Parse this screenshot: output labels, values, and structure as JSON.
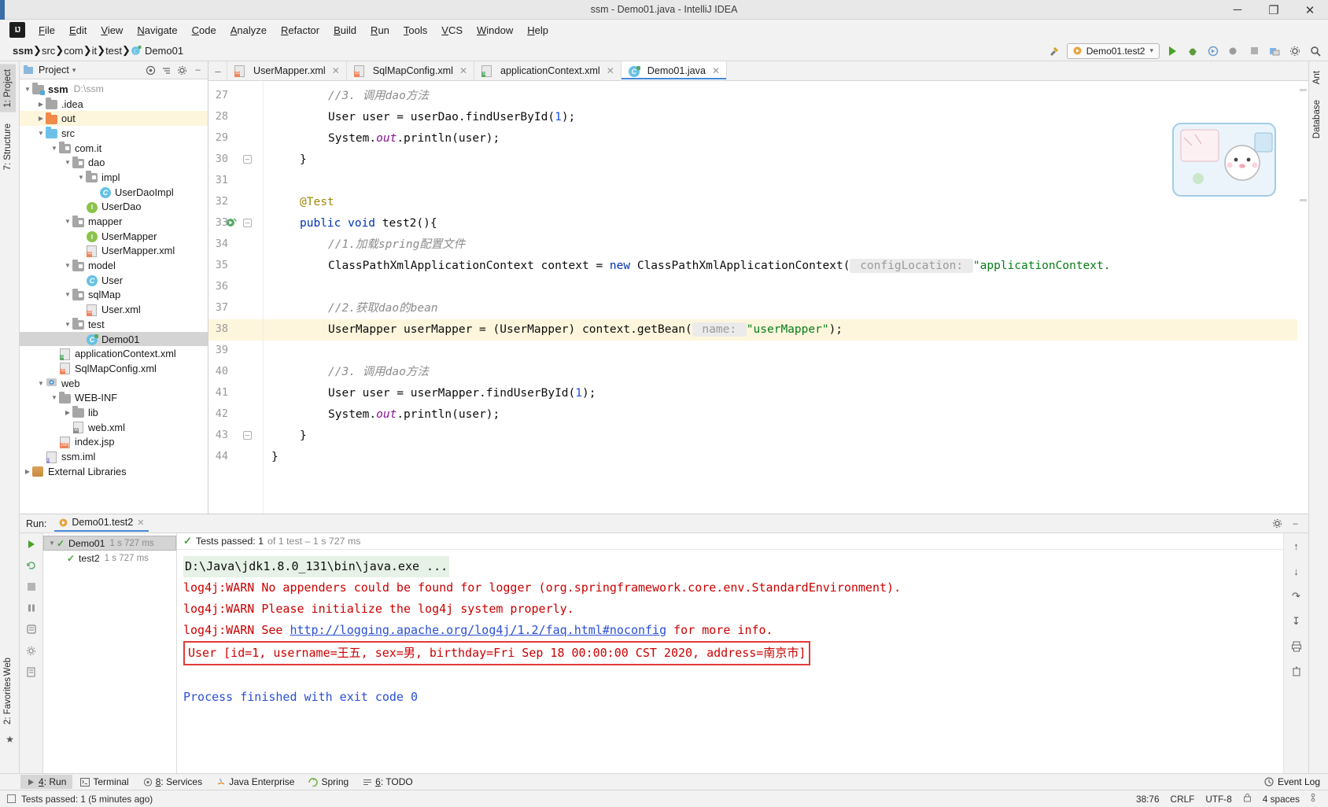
{
  "window": {
    "title": "ssm - Demo01.java - IntelliJ IDEA",
    "minimize": "─",
    "maximize": "❐",
    "close": "✕",
    "logo": "IJ"
  },
  "menu": {
    "items": [
      "File",
      "Edit",
      "View",
      "Navigate",
      "Code",
      "Analyze",
      "Refactor",
      "Build",
      "Run",
      "Tools",
      "VCS",
      "Window",
      "Help"
    ]
  },
  "navbar": {
    "crumbs": [
      "ssm",
      "src",
      "com",
      "it",
      "test",
      "Demo01"
    ],
    "separator": "❯",
    "run_config": "Demo01.test2",
    "run_config_chevron": "▾"
  },
  "left_rail": {
    "project": "1: Project",
    "structure": "7: Structure",
    "web": "Web",
    "favorites": "2: Favorites"
  },
  "right_rail": {
    "ant": "Ant",
    "database": "Database"
  },
  "project_panel": {
    "title": "Project",
    "title_chevron": "▾",
    "tree": [
      {
        "depth": 0,
        "arrow": "▼",
        "icon": "module-folder",
        "label": "ssm",
        "bold": true,
        "sub": "D:\\ssm",
        "state": "normal"
      },
      {
        "depth": 1,
        "arrow": "▶",
        "icon": "folder-grey",
        "label": ".idea",
        "state": "normal"
      },
      {
        "depth": 1,
        "arrow": "▶",
        "icon": "folder-orange",
        "label": "out",
        "state": "highlight"
      },
      {
        "depth": 1,
        "arrow": "▼",
        "icon": "folder-src",
        "label": "src",
        "state": "normal"
      },
      {
        "depth": 2,
        "arrow": "▼",
        "icon": "package",
        "label": "com.it",
        "state": "normal"
      },
      {
        "depth": 3,
        "arrow": "▼",
        "icon": "package",
        "label": "dao",
        "state": "normal"
      },
      {
        "depth": 4,
        "arrow": "▼",
        "icon": "package",
        "label": "impl",
        "state": "normal"
      },
      {
        "depth": 5,
        "arrow": "",
        "icon": "java-class",
        "label": "UserDaoImpl",
        "state": "normal"
      },
      {
        "depth": 4,
        "arrow": "",
        "icon": "java-interface",
        "label": "UserDao",
        "state": "normal"
      },
      {
        "depth": 3,
        "arrow": "▼",
        "icon": "package",
        "label": "mapper",
        "state": "normal"
      },
      {
        "depth": 4,
        "arrow": "",
        "icon": "java-interface",
        "label": "UserMapper",
        "state": "normal"
      },
      {
        "depth": 4,
        "arrow": "",
        "icon": "xml-file",
        "label": "UserMapper.xml",
        "state": "normal"
      },
      {
        "depth": 3,
        "arrow": "▼",
        "icon": "package",
        "label": "model",
        "state": "normal"
      },
      {
        "depth": 4,
        "arrow": "",
        "icon": "java-class",
        "label": "User",
        "state": "normal"
      },
      {
        "depth": 3,
        "arrow": "▼",
        "icon": "package",
        "label": "sqlMap",
        "state": "normal"
      },
      {
        "depth": 4,
        "arrow": "",
        "icon": "xml-file",
        "label": "User.xml",
        "state": "normal"
      },
      {
        "depth": 3,
        "arrow": "▼",
        "icon": "package",
        "label": "test",
        "state": "normal"
      },
      {
        "depth": 4,
        "arrow": "",
        "icon": "java-test-class",
        "label": "Demo01",
        "state": "selected"
      },
      {
        "depth": 2,
        "arrow": "",
        "icon": "xml-spring",
        "label": "applicationContext.xml",
        "state": "normal"
      },
      {
        "depth": 2,
        "arrow": "",
        "icon": "xml-file",
        "label": "SqlMapConfig.xml",
        "state": "normal"
      },
      {
        "depth": 1,
        "arrow": "▼",
        "icon": "folder-web",
        "label": "web",
        "state": "normal"
      },
      {
        "depth": 2,
        "arrow": "▼",
        "icon": "folder-grey",
        "label": "WEB-INF",
        "state": "normal"
      },
      {
        "depth": 3,
        "arrow": "▶",
        "icon": "folder-grey",
        "label": "lib",
        "state": "normal"
      },
      {
        "depth": 3,
        "arrow": "",
        "icon": "xml-web",
        "label": "web.xml",
        "state": "normal"
      },
      {
        "depth": 2,
        "arrow": "",
        "icon": "jsp-file",
        "label": "index.jsp",
        "state": "normal"
      },
      {
        "depth": 1,
        "arrow": "",
        "icon": "iml-file",
        "label": "ssm.iml",
        "state": "normal"
      },
      {
        "depth": 0,
        "arrow": "▶",
        "icon": "library",
        "label": "External Libraries",
        "state": "normal"
      }
    ]
  },
  "editor": {
    "tabs": [
      {
        "label": "UserMapper.xml",
        "icon": "xml-file",
        "active": false,
        "close": "✕"
      },
      {
        "label": "SqlMapConfig.xml",
        "icon": "xml-file",
        "active": false,
        "close": "✕"
      },
      {
        "label": "applicationContext.xml",
        "icon": "xml-spring",
        "active": false,
        "close": "✕"
      },
      {
        "label": "Demo01.java",
        "icon": "java-test-class",
        "active": true,
        "close": "✕"
      }
    ],
    "first_line": 27,
    "lines": [
      {
        "num": 27,
        "indent": 8,
        "segments": [
          {
            "t": "//3. 调用dao方法",
            "c": "cmt"
          }
        ]
      },
      {
        "num": 28,
        "indent": 8,
        "segments": [
          {
            "t": "User user = userDao.findUserById(",
            "c": ""
          },
          {
            "t": "1",
            "c": "num"
          },
          {
            "t": ");",
            "c": ""
          }
        ]
      },
      {
        "num": 29,
        "indent": 8,
        "segments": [
          {
            "t": "System.",
            "c": ""
          },
          {
            "t": "out",
            "c": "fld"
          },
          {
            "t": ".println(user);",
            "c": ""
          }
        ]
      },
      {
        "num": 30,
        "indent": 4,
        "fold": "─",
        "segments": [
          {
            "t": "}",
            "c": ""
          }
        ]
      },
      {
        "num": 31,
        "indent": 0,
        "segments": []
      },
      {
        "num": 32,
        "indent": 4,
        "segments": [
          {
            "t": "@Test",
            "c": "ann"
          }
        ]
      },
      {
        "num": 33,
        "indent": 4,
        "fold": "─",
        "runmark": true,
        "segments": [
          {
            "t": "public void ",
            "c": "kw"
          },
          {
            "t": "test2(){",
            "c": ""
          }
        ]
      },
      {
        "num": 34,
        "indent": 8,
        "segments": [
          {
            "t": "//1.加载spring配置文件",
            "c": "cmt"
          }
        ]
      },
      {
        "num": 35,
        "indent": 8,
        "segments": [
          {
            "t": "ClassPathXmlApplicationContext context = ",
            "c": ""
          },
          {
            "t": "new ",
            "c": "kw"
          },
          {
            "t": "ClassPathXmlApplicationContext(",
            "c": ""
          },
          {
            "t": " configLocation: ",
            "c": "hint"
          },
          {
            "t": "\"applicationContext.",
            "c": "str"
          }
        ]
      },
      {
        "num": 36,
        "indent": 0,
        "segments": []
      },
      {
        "num": 37,
        "indent": 8,
        "segments": [
          {
            "t": "//2.获取dao的bean",
            "c": "cmt"
          }
        ]
      },
      {
        "num": 38,
        "indent": 8,
        "highlight": true,
        "segments": [
          {
            "t": "UserMapper userMapper = (UserMapper) context.getBean(",
            "c": ""
          },
          {
            "t": " name: ",
            "c": "hint"
          },
          {
            "t": "\"userMapper\"",
            "c": "str"
          },
          {
            "t": ");",
            "c": ""
          }
        ]
      },
      {
        "num": 39,
        "indent": 0,
        "segments": []
      },
      {
        "num": 40,
        "indent": 8,
        "segments": [
          {
            "t": "//3. 调用dao方法",
            "c": "cmt"
          }
        ]
      },
      {
        "num": 41,
        "indent": 8,
        "segments": [
          {
            "t": "User user = userMapper.findUserById(",
            "c": ""
          },
          {
            "t": "1",
            "c": "num"
          },
          {
            "t": ");",
            "c": ""
          }
        ]
      },
      {
        "num": 42,
        "indent": 8,
        "segments": [
          {
            "t": "System.",
            "c": ""
          },
          {
            "t": "out",
            "c": "fld"
          },
          {
            "t": ".println(user);",
            "c": ""
          }
        ]
      },
      {
        "num": 43,
        "indent": 4,
        "fold": "─",
        "segments": [
          {
            "t": "}",
            "c": ""
          }
        ]
      },
      {
        "num": 44,
        "indent": 0,
        "segments": [
          {
            "t": "}",
            "c": ""
          }
        ]
      }
    ]
  },
  "run_panel": {
    "label": "Run:",
    "tab": "Demo01.test2",
    "tab_close": "✕",
    "status_check": "✓",
    "status_main": "Tests passed: 1",
    "status_detail": "of 1 test – 1 s 727 ms",
    "tests": [
      {
        "depth": 0,
        "arrow": "▼",
        "label": "Demo01",
        "time": "1 s 727 ms",
        "selected": true,
        "icon": "check-green"
      },
      {
        "depth": 1,
        "arrow": "",
        "label": "test2",
        "time": "1 s 727 ms",
        "selected": false,
        "icon": "check-green"
      }
    ],
    "console": [
      {
        "type": "cmd",
        "text": "D:\\Java\\jdk1.8.0_131\\bin\\java.exe ..."
      },
      {
        "type": "err",
        "text": "log4j:WARN No appenders could be found for logger (org.springframework.core.env.StandardEnvironment)."
      },
      {
        "type": "err",
        "text": "log4j:WARN Please initialize the log4j system properly."
      },
      {
        "type": "err-link",
        "prefix": "log4j:WARN See ",
        "link": "http://logging.apache.org/log4j/1.2/faq.html#noconfig",
        "suffix": " for more info."
      },
      {
        "type": "boxed",
        "text": "User [id=1, username=王五, sex=男, birthday=Fri Sep 18 00:00:00 CST 2020, address=南京市]"
      },
      {
        "type": "blank",
        "text": ""
      },
      {
        "type": "blue",
        "text": "Process finished with exit code 0"
      }
    ]
  },
  "bottom_bar": {
    "items": [
      {
        "label": "4: Run",
        "icon": "run-icon",
        "selected": true
      },
      {
        "label": "Terminal",
        "icon": "terminal-icon",
        "selected": false
      },
      {
        "label": "8: Services",
        "icon": "services-icon",
        "selected": false
      },
      {
        "label": "Java Enterprise",
        "icon": "java-ee-icon",
        "selected": false
      },
      {
        "label": "Spring",
        "icon": "spring-icon",
        "selected": false
      },
      {
        "label": "6: TODO",
        "icon": "todo-icon",
        "selected": false
      }
    ],
    "event_log": "Event Log"
  },
  "status_bar": {
    "message": "Tests passed: 1 (5 minutes ago)",
    "caret": "38:76",
    "line_sep": "CRLF",
    "encoding": "UTF-8",
    "indent": "4 spaces"
  },
  "colors": {
    "accent": "#4688d6",
    "selection": "#d4d4d4",
    "highlight": "#fdf6dd",
    "error_text": "#cc0000",
    "box_border": "#e33a3a",
    "link": "#2a4fd6",
    "string": "#067d17",
    "keyword": "#0033b3",
    "comment": "#8c8c8c"
  }
}
